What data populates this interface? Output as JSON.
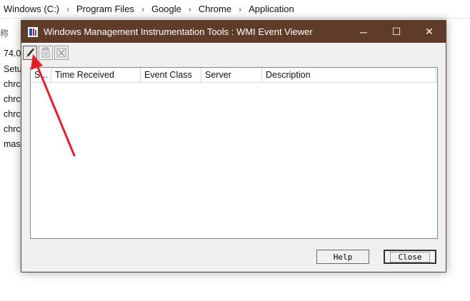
{
  "breadcrumb": [
    "Windows (C:)",
    "Program Files",
    "Google",
    "Chrome",
    "Application"
  ],
  "explorer": {
    "column_header": "称",
    "files": [
      "74.0",
      "Setu",
      "chrc",
      "chrc",
      "chrc",
      "chrc",
      "mas"
    ]
  },
  "window": {
    "title": "Windows Management Instrumentation Tools : WMI Event Viewer",
    "minimize": "─",
    "maximize": "☐",
    "close": "✕"
  },
  "toolbar": {
    "buttons": [
      "register-event-filter-icon",
      "properties-icon",
      "clear-events-icon"
    ]
  },
  "table": {
    "columns": [
      "S...",
      "Time Received",
      "Event Class",
      "Server",
      "Description"
    ],
    "rows": []
  },
  "buttons": {
    "help": "Help",
    "close": "Close"
  },
  "colors": {
    "titlebar": "#5f3c29",
    "annotation_arrow": "#e0212d"
  }
}
